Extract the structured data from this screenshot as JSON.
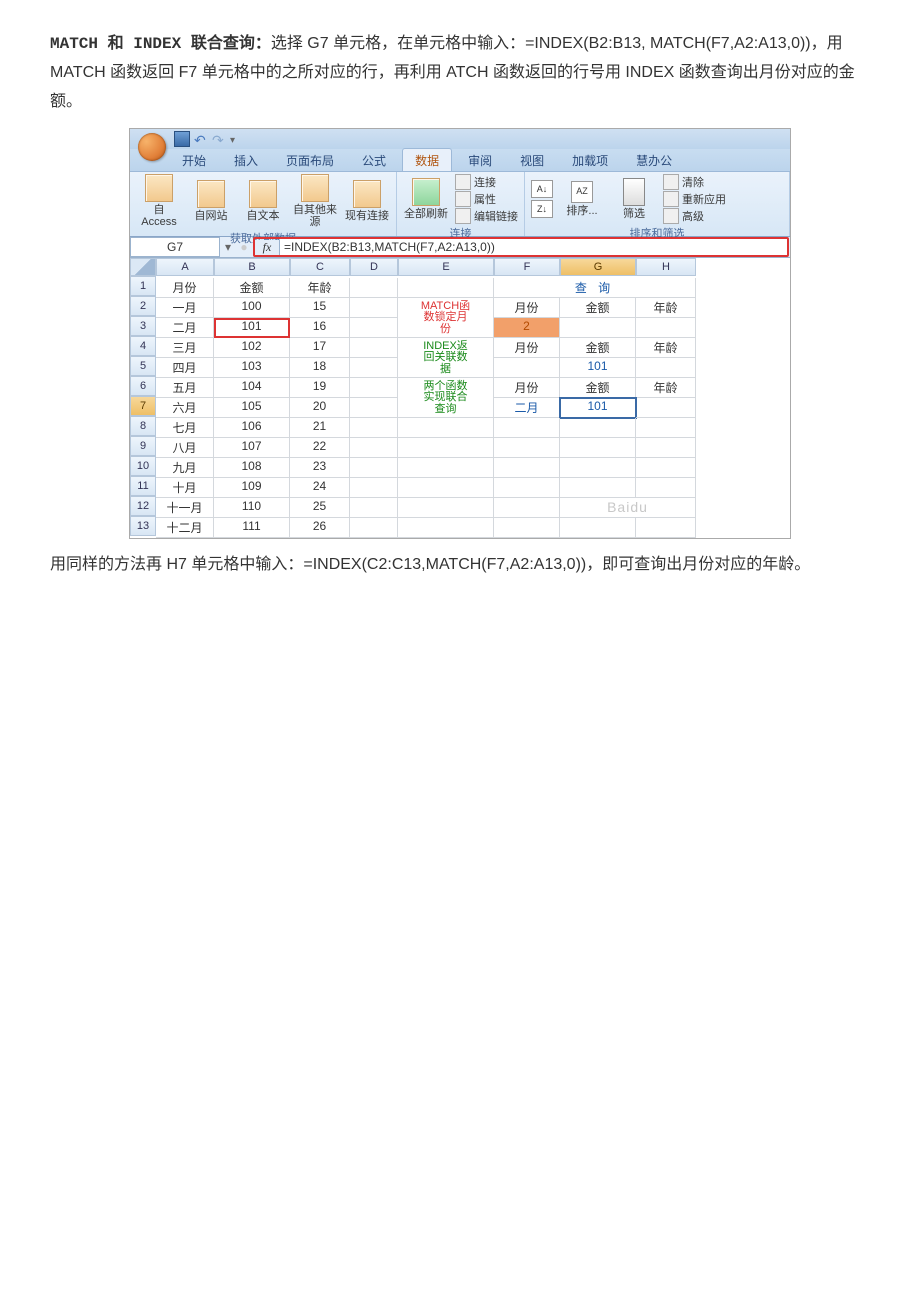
{
  "doc": {
    "intro_title": "MATCH 和 INDEX 联合查询：",
    "intro_rest": "选择 G7 单元格，在单元格中输入：=INDEX(B2:B13, MATCH(F7,A2:A13,0))，用 MATCH 函数返回 F7 单元格中的之所对应的行，再利用 ATCH 函数返回的行号用 INDEX 函数查询出月份对应的金额。",
    "outro": "用同样的方法再 H7 单元格中输入：=INDEX(C2:C13,MATCH(F7,A2:A13,0))，即可查询出月份对应的年龄。"
  },
  "tabs": {
    "start": "开始",
    "insert": "插入",
    "layout": "页面布局",
    "formula": "公式",
    "data": "数据",
    "review": "审阅",
    "view": "视图",
    "addin": "加载项",
    "huiban": "慧办公"
  },
  "ribbon": {
    "ext_access": "自 Access",
    "ext_web": "自网站",
    "ext_text": "自文本",
    "ext_other": "自其他来源",
    "ext_existing": "现有连接",
    "ext_group": "获取外部数据",
    "refresh": "全部刷新",
    "conn1": "连接",
    "conn2": "属性",
    "conn3": "编辑链接",
    "conn_group": "连接",
    "sort": "排序...",
    "filter": "筛选",
    "f_clear": "清除",
    "f_reapply": "重新应用",
    "f_adv": "高级",
    "sort_group": "排序和筛选"
  },
  "formula_bar": {
    "name_box": "G7",
    "fx": "fx",
    "formula": "=INDEX(B2:B13,MATCH(F7,A2:A13,0))"
  },
  "cols": {
    "A": "A",
    "B": "B",
    "C": "C",
    "D": "D",
    "E": "E",
    "F": "F",
    "G": "G",
    "H": "H"
  },
  "headers": {
    "month": "月份",
    "amount": "金额",
    "age": "年龄",
    "query": "查  询"
  },
  "rows": [
    {
      "n": "1"
    },
    {
      "n": "2",
      "A": "一月",
      "B": "100",
      "C": "15"
    },
    {
      "n": "3",
      "A": "二月",
      "B": "101",
      "C": "16"
    },
    {
      "n": "4",
      "A": "三月",
      "B": "102",
      "C": "17"
    },
    {
      "n": "5",
      "A": "四月",
      "B": "103",
      "C": "18"
    },
    {
      "n": "6",
      "A": "五月",
      "B": "104",
      "C": "19"
    },
    {
      "n": "7",
      "A": "六月",
      "B": "105",
      "C": "20"
    },
    {
      "n": "8",
      "A": "七月",
      "B": "106",
      "C": "21"
    },
    {
      "n": "9",
      "A": "八月",
      "B": "107",
      "C": "22"
    },
    {
      "n": "10",
      "A": "九月",
      "B": "108",
      "C": "23"
    },
    {
      "n": "11",
      "A": "十月",
      "B": "109",
      "C": "24"
    },
    {
      "n": "12",
      "A": "十一月",
      "B": "110",
      "C": "25"
    },
    {
      "n": "13",
      "A": "十二月",
      "B": "111",
      "C": "26"
    }
  ],
  "ecol": {
    "e23_1": "MATCH函",
    "e23_2": "数锁定月",
    "e23_3": "份",
    "e45_1": "INDEX返",
    "e45_2": "回关联数",
    "e45_3": "据",
    "e67_1": "两个函数",
    "e67_2": "实现联合",
    "e67_3": "查询"
  },
  "query": {
    "f2": "月份",
    "g2": "金额",
    "h2": "年龄",
    "f3": "2",
    "f4": "月份",
    "g4": "金额",
    "h4": "年龄",
    "g5": "101",
    "f6": "月份",
    "g6": "金额",
    "h6": "年龄",
    "f7": "二月",
    "g7": "101"
  },
  "watermark": "Baidu"
}
